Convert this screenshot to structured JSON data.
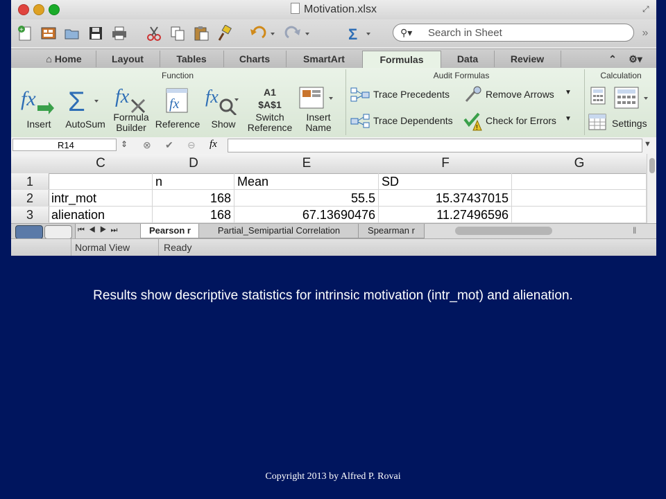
{
  "window": {
    "title": "Motivation.xlsx"
  },
  "colors": {
    "slide_bg": "#00155e",
    "ribbon_bg": "#e8f2e5",
    "accent_blue": "#2d6db5"
  },
  "search": {
    "placeholder": "Search in Sheet"
  },
  "tabs": [
    "Home",
    "Layout",
    "Tables",
    "Charts",
    "SmartArt",
    "Formulas",
    "Data",
    "Review"
  ],
  "active_tab": "Formulas",
  "ribbon": {
    "groups": {
      "function": "Function",
      "audit": "Audit Formulas",
      "calculation": "Calculation"
    },
    "function_buttons": [
      "Insert",
      "AutoSum",
      "Formula\nBuilder",
      "Reference",
      "Show",
      "Switch\nReference",
      "Insert\nName"
    ],
    "switch_ref_icon_text": "A1\n$A$1",
    "audit_buttons": [
      "Trace Precedents",
      "Remove Arrows",
      "Trace Dependents",
      "Check for Errors"
    ],
    "calc_buttons": [
      "Settings"
    ]
  },
  "formula_bar": {
    "name_box": "R14",
    "fx": "fx"
  },
  "grid": {
    "columns": [
      "C",
      "D",
      "E",
      "F",
      "G"
    ],
    "rows": [
      {
        "num": "1",
        "cells": [
          "",
          "n",
          "Mean",
          "SD",
          ""
        ]
      },
      {
        "num": "2",
        "cells": [
          "intr_mot",
          "168",
          "55.5",
          "15.37437015",
          ""
        ]
      },
      {
        "num": "3",
        "cells": [
          "alienation",
          "168",
          "67.13690476",
          "11.27496596",
          ""
        ]
      }
    ]
  },
  "sheets": [
    "Pearson r",
    "Partial_Semipartial Correlation",
    "Spearman r"
  ],
  "active_sheet": "Pearson r",
  "status": {
    "view": "Normal View",
    "state": "Ready"
  },
  "caption": "Results show descriptive statistics for intrinsic motivation (intr_mot) and alienation.",
  "copyright": "Copyright 2013 by Alfred P. Rovai"
}
